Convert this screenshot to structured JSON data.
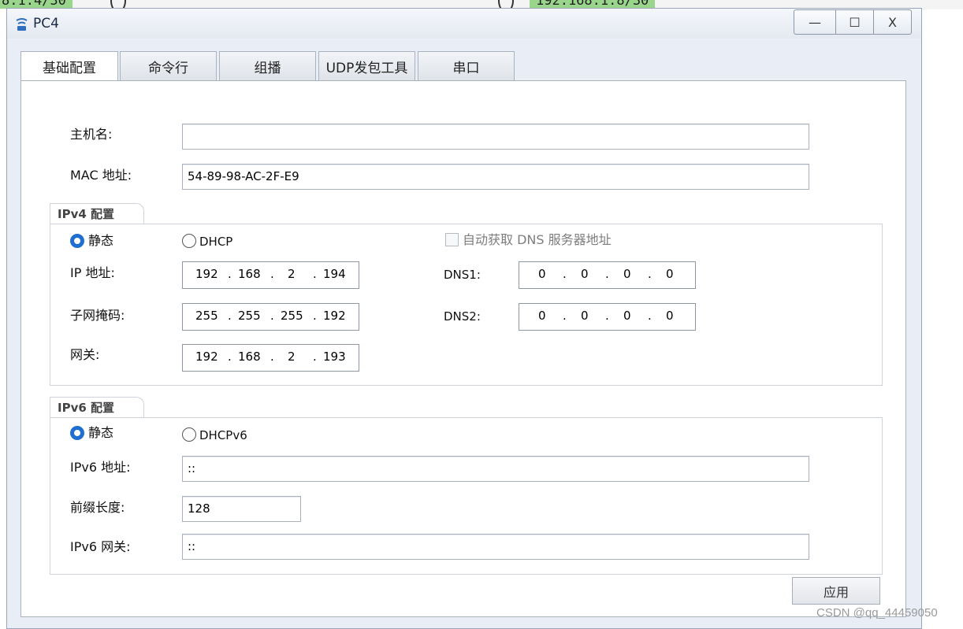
{
  "background": {
    "left_label": "8.1.4/30",
    "right_label": "192.168.1.8/30"
  },
  "window": {
    "title": "PC4",
    "icon": "pc-icon",
    "controls": {
      "minimize": "—",
      "maximize": "☐",
      "close": "X"
    }
  },
  "tabs": [
    {
      "label": "基础配置",
      "active": true
    },
    {
      "label": "命令行",
      "active": false
    },
    {
      "label": "组播",
      "active": false
    },
    {
      "label": "UDP发包工具",
      "active": false
    },
    {
      "label": "串口",
      "active": false
    }
  ],
  "basic": {
    "hostname_label": "主机名:",
    "hostname_value": "",
    "mac_label": "MAC 地址:",
    "mac_value": "54-89-98-AC-2F-E9"
  },
  "ipv4": {
    "section_title": "IPv4 配置",
    "mode_static_label": "静态",
    "mode_dhcp_label": "DHCP",
    "mode_selected": "static",
    "auto_dns_label": "自动获取 DNS 服务器地址",
    "auto_dns_checked": false,
    "ip_label": "IP 地址:",
    "ip": [
      "192",
      "168",
      "2",
      "194"
    ],
    "mask_label": "子网掩码:",
    "mask": [
      "255",
      "255",
      "255",
      "192"
    ],
    "gateway_label": "网关:",
    "gateway": [
      "192",
      "168",
      "2",
      "193"
    ],
    "dns1_label": "DNS1:",
    "dns1": [
      "0",
      "0",
      "0",
      "0"
    ],
    "dns2_label": "DNS2:",
    "dns2": [
      "0",
      "0",
      "0",
      "0"
    ],
    "dot": "."
  },
  "ipv6": {
    "section_title": "IPv6 配置",
    "mode_static_label": "静态",
    "mode_dhcp_label": "DHCPv6",
    "mode_selected": "static",
    "addr_label": "IPv6 地址:",
    "addr_value": "::",
    "prefix_label": "前缀长度:",
    "prefix_value": "128",
    "gateway_label": "IPv6 网关:",
    "gateway_value": "::"
  },
  "apply_label": "应用",
  "watermark": "CSDN @qq_44459050",
  "colors": {
    "accent": "#1f6fd1",
    "bg_label": "#9ad58c"
  }
}
